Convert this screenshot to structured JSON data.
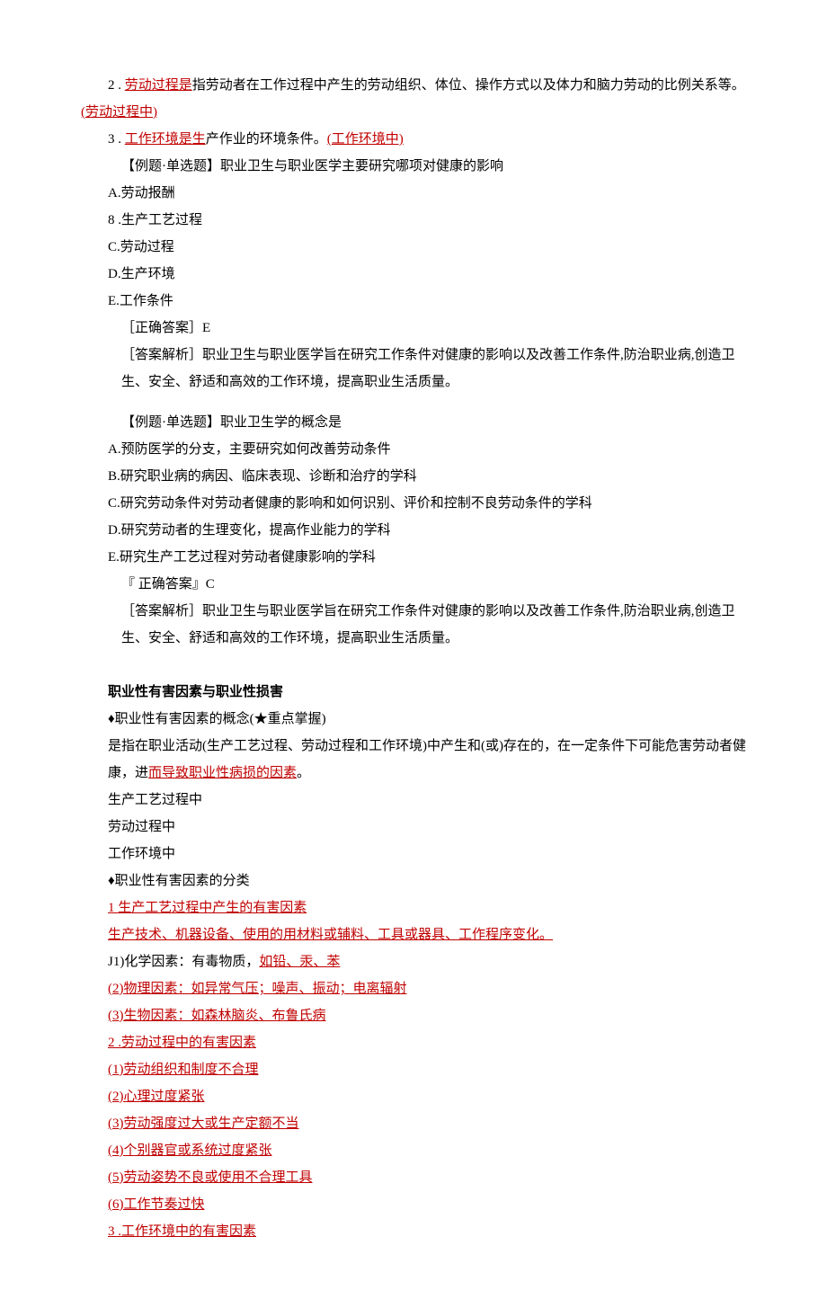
{
  "p1": {
    "prefix": "2 .",
    "redA": "劳动过程是",
    "rest": "指劳动者在工作过程中产生的劳动组织、体位、操作方式以及体力和脑力劳动的比例关系等。"
  },
  "p1b": "(劳动过程中)",
  "p2": {
    "prefix": "3 .",
    "redA": "工作环境是生",
    "rest": "产作业的环境条件。",
    "redB": "(工作环境中)"
  },
  "q1": {
    "title": "【例题·单选题】职业卫生与职业医学主要研究哪项对健康的影响",
    "optA": "A.劳动报酬",
    "optB": "8 .生产工艺过程",
    "optC": "C.劳动过程",
    "optD": "D.生产环境",
    "optE": "E.工作条件",
    "answer": "［正确答案］E",
    "analysis": "［答案解析］职业卫生与职业医学旨在研究工作条件对健康的影响以及改善工作条件,防治职业病,创造卫生、安全、舒适和高效的工作环境，提高职业生活质量。"
  },
  "q2": {
    "title": "【例题·单选题】职业卫生学的概念是",
    "optA": "A.预防医学的分支，主要研究如何改善劳动条件",
    "optB": "B.研究职业病的病因、临床表现、诊断和治疗的学科",
    "optC": "C.研究劳动条件对劳动者健康的影响和如何识别、评价和控制不良劳动条件的学科",
    "optD": "D.研究劳动者的生理变化，提高作业能力的学科",
    "optE": "E.研究生产工艺过程对劳动者健康影响的学科",
    "answer": "『 正确答案』C",
    "analysis": "［答案解析］职业卫生与职业医学旨在研究工作条件对健康的影响以及改善工作条件,防治职业病,创造卫生、安全、舒适和高效的工作环境，提高职业生活质量。"
  },
  "section": {
    "title": "职业性有害因素与职业性损害",
    "concept": "♦职业性有害因素的概念(★重点掌握)",
    "def1": "是指在职业活动(生产工艺过程、劳动过程和工作环境)中产生和(或)存在的，在一定条件下可能危害劳动者健康，进",
    "def1b": "而导致职业性病损的因素",
    "def1c": "。",
    "l1": "生产工艺过程中",
    "l2": "劳动过程中",
    "l3": "工作环境中",
    "classify": "♦职业性有害因素的分类",
    "h1": "1 生产工艺过程中产生的有害因素",
    "h1sub": "生产技术、机器设备、使用的用材料或辅料、工具或器具、工作程序变化。",
    "h1a_pre": "J1)化学因素：有毒物质，",
    "h1a_red": "如铅、汞、苯",
    "h1b": "(2)物理因素：如异常气压；噪声、振动；电离辐射",
    "h1c": "(3)生物因素：如森林脑炎、布鲁氏病",
    "h2pre": "2",
    "h2": " .劳动过程中的有害因素",
    "h2a": "(1)劳动组织和制度不合理",
    "h2b": "(2)心理过度紧张",
    "h2c": "(3)劳动强度过大或生产定额不当",
    "h2d": "(4)个别器官或系统过度紧张",
    "h2e": "(5)劳动姿势不良或使用不合理工具",
    "h2f": "(6)工作节奏过快",
    "h3pre": "3",
    "h3": " .工作环境中的有害因素"
  }
}
